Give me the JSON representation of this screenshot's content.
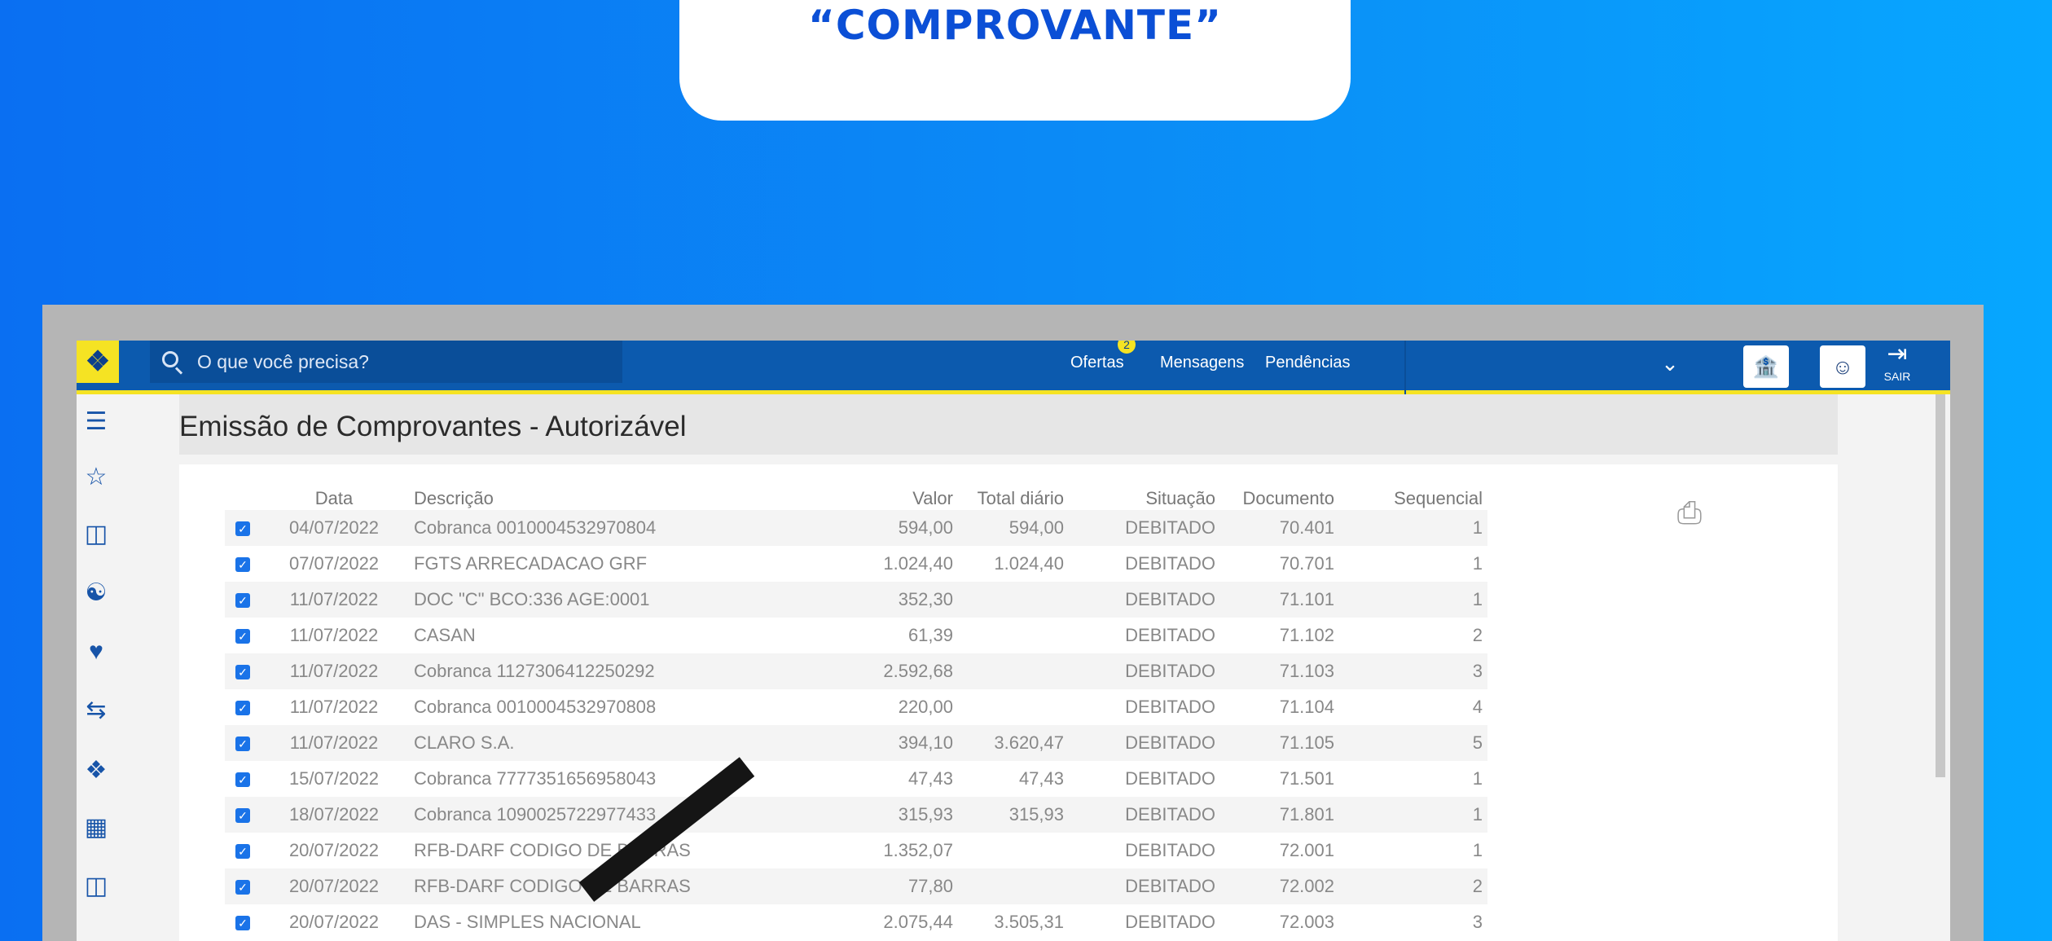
{
  "callout": {
    "text": "“COMPROVANTE”"
  },
  "header": {
    "search_placeholder": "O que você precisa?",
    "offers_label": "Ofertas",
    "offers_badge": "2",
    "messages_label": "Mensagens",
    "pending_label": "Pendências",
    "exit_label": "SAIR"
  },
  "sidebar": {
    "icons": [
      "menu-icon",
      "bookmark-star-icon",
      "wallet-icon",
      "org-chart-icon",
      "hand-coin-icon",
      "transfer-icon",
      "diamond-cluster-icon",
      "cash-icon",
      "wallet-icon"
    ]
  },
  "page": {
    "title": "Emissão de Comprovantes - Autorizável"
  },
  "table": {
    "headers": {
      "date": "Data",
      "description": "Descrição",
      "value": "Valor",
      "daily_total": "Total diário",
      "status": "Situação",
      "document": "Documento",
      "sequence": "Sequencial"
    },
    "rows": [
      {
        "date": "04/07/2022",
        "description": "Cobranca 0010004532970804",
        "value": "594,00",
        "daily_total": "594,00",
        "status": "DEBITADO",
        "document": "70.401",
        "sequence": "1"
      },
      {
        "date": "07/07/2022",
        "description": "FGTS ARRECADACAO GRF",
        "value": "1.024,40",
        "daily_total": "1.024,40",
        "status": "DEBITADO",
        "document": "70.701",
        "sequence": "1"
      },
      {
        "date": "11/07/2022",
        "description": "DOC \"C\" BCO:336 AGE:0001",
        "value": "352,30",
        "daily_total": "",
        "status": "DEBITADO",
        "document": "71.101",
        "sequence": "1"
      },
      {
        "date": "11/07/2022",
        "description": "CASAN",
        "value": "61,39",
        "daily_total": "",
        "status": "DEBITADO",
        "document": "71.102",
        "sequence": "2"
      },
      {
        "date": "11/07/2022",
        "description": "Cobranca 1127306412250292",
        "value": "2.592,68",
        "daily_total": "",
        "status": "DEBITADO",
        "document": "71.103",
        "sequence": "3"
      },
      {
        "date": "11/07/2022",
        "description": "Cobranca 0010004532970808",
        "value": "220,00",
        "daily_total": "",
        "status": "DEBITADO",
        "document": "71.104",
        "sequence": "4"
      },
      {
        "date": "11/07/2022",
        "description": "CLARO S.A.",
        "value": "394,10",
        "daily_total": "3.620,47",
        "status": "DEBITADO",
        "document": "71.105",
        "sequence": "5"
      },
      {
        "date": "15/07/2022",
        "description": "Cobranca 7777351656958043",
        "value": "47,43",
        "daily_total": "47,43",
        "status": "DEBITADO",
        "document": "71.501",
        "sequence": "1"
      },
      {
        "date": "18/07/2022",
        "description": "Cobranca 1090025722977433",
        "value": "315,93",
        "daily_total": "315,93",
        "status": "DEBITADO",
        "document": "71.801",
        "sequence": "1"
      },
      {
        "date": "20/07/2022",
        "description": "RFB-DARF CODIGO DE BARRAS",
        "value": "1.352,07",
        "daily_total": "",
        "status": "DEBITADO",
        "document": "72.001",
        "sequence": "1"
      },
      {
        "date": "20/07/2022",
        "description": "RFB-DARF CODIGO DE BARRAS",
        "value": "77,80",
        "daily_total": "",
        "status": "DEBITADO",
        "document": "72.002",
        "sequence": "2"
      },
      {
        "date": "20/07/2022",
        "description": "DAS - SIMPLES NACIONAL",
        "value": "2.075,44",
        "daily_total": "3.505,31",
        "status": "DEBITADO",
        "document": "72.003",
        "sequence": "3"
      }
    ]
  }
}
